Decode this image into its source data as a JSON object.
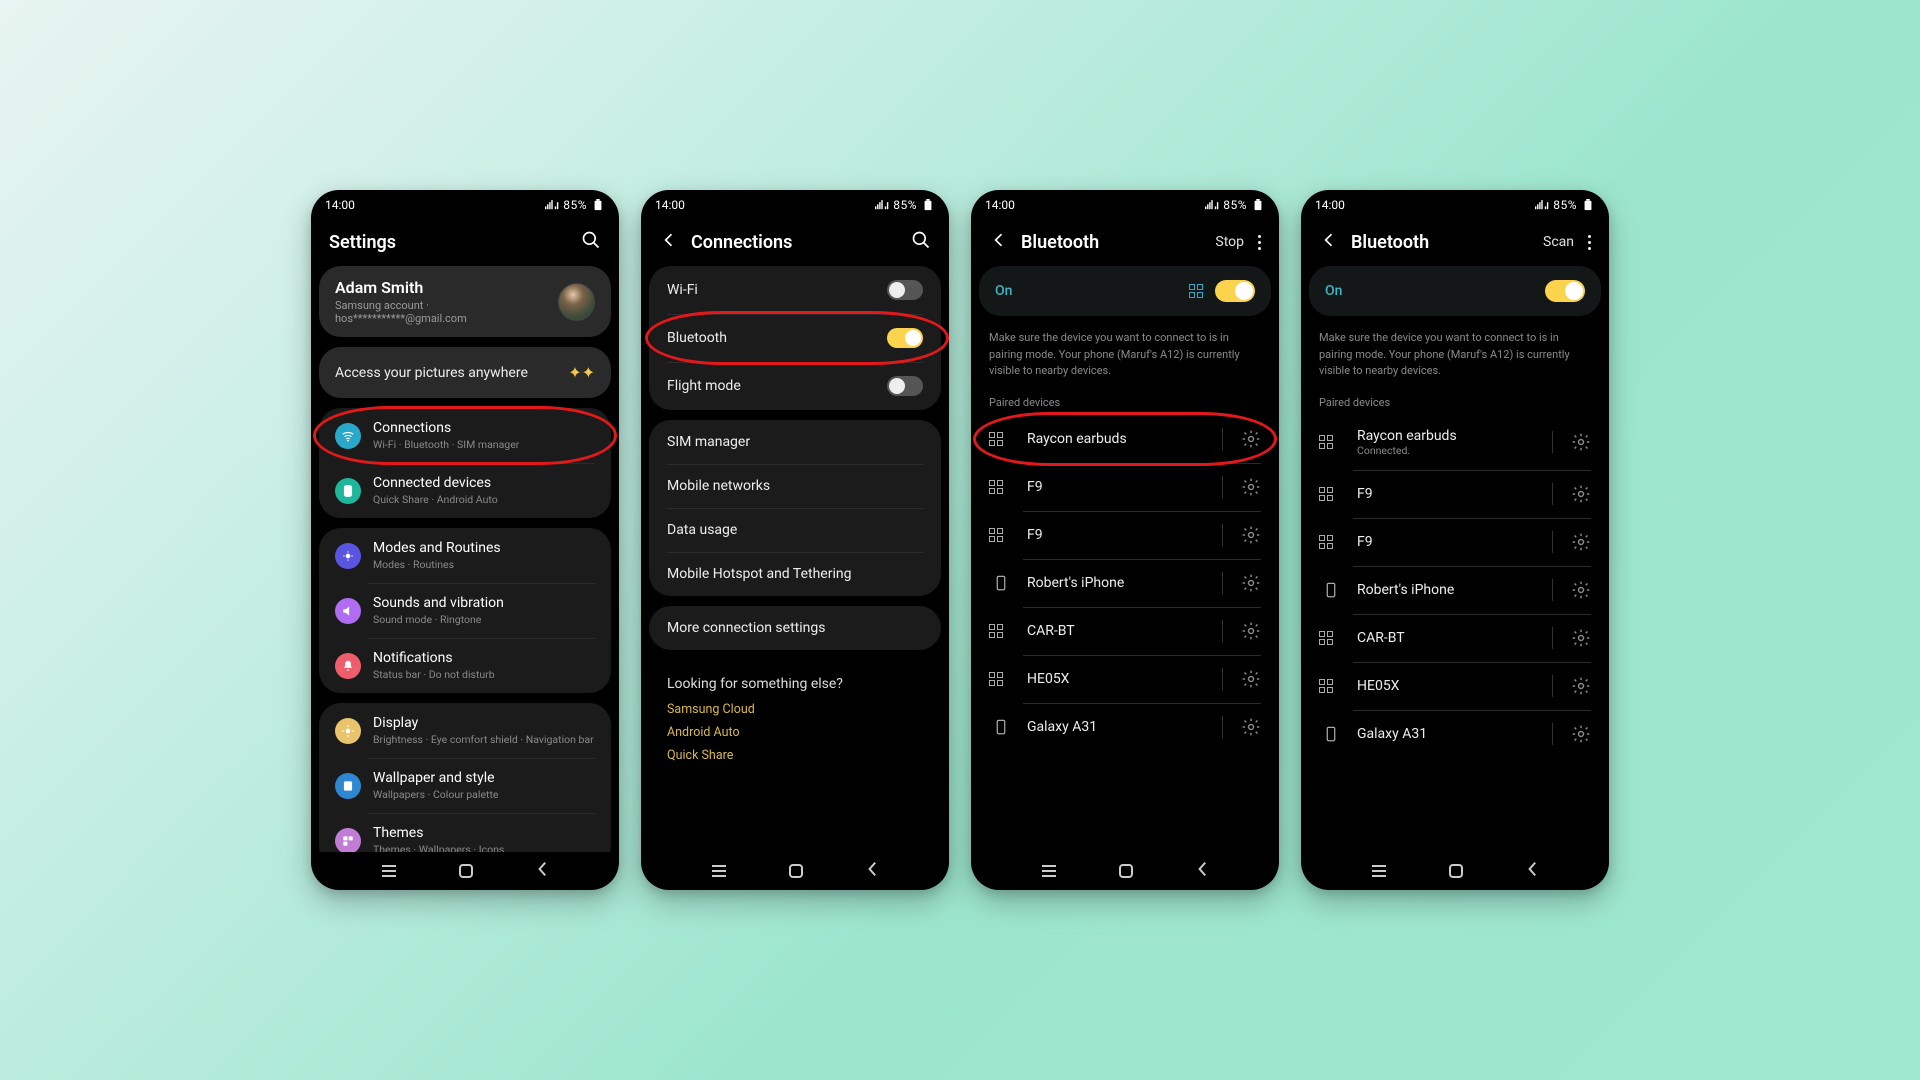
{
  "status": {
    "time": "14:00",
    "battery": "85%"
  },
  "s1": {
    "title": "Settings",
    "profile": {
      "name": "Adam Smith",
      "sub": "Samsung account · hos***********@gmail.com"
    },
    "promo": "Access your pictures anywhere",
    "groups": [
      {
        "items": [
          {
            "icon": "wifi",
            "color": "#2aa8c9",
            "label": "Connections",
            "sub": "Wi-Fi · Bluetooth · SIM manager",
            "hl": true
          },
          {
            "icon": "link",
            "color": "#1fb79b",
            "label": "Connected devices",
            "sub": "Quick Share · Android Auto"
          }
        ]
      },
      {
        "items": [
          {
            "icon": "modes",
            "color": "#5a55e0",
            "label": "Modes and Routines",
            "sub": "Modes · Routines"
          },
          {
            "icon": "sound",
            "color": "#b06cf2",
            "label": "Sounds and vibration",
            "sub": "Sound mode · Ringtone"
          },
          {
            "icon": "bell",
            "color": "#ee5d6c",
            "label": "Notifications",
            "sub": "Status bar · Do not disturb"
          }
        ]
      },
      {
        "items": [
          {
            "icon": "sun",
            "color": "#e9c46a",
            "label": "Display",
            "sub": "Brightness · Eye comfort shield · Navigation bar"
          },
          {
            "icon": "wall",
            "color": "#2f86d1",
            "label": "Wallpaper and style",
            "sub": "Wallpapers · Colour palette"
          },
          {
            "icon": "theme",
            "color": "#c17dd6",
            "label": "Themes",
            "sub": "Themes · Wallpapers · Icons"
          }
        ]
      }
    ]
  },
  "s2": {
    "title": "Connections",
    "rows": [
      {
        "label": "Wi-Fi",
        "toggle": true,
        "on": false
      },
      {
        "label": "Bluetooth",
        "toggle": true,
        "on": true,
        "hl": true
      },
      {
        "label": "Flight mode",
        "toggle": true,
        "on": false
      }
    ],
    "rows2": [
      {
        "label": "SIM manager"
      },
      {
        "label": "Mobile networks"
      },
      {
        "label": "Data usage"
      },
      {
        "label": "Mobile Hotspot and Tethering"
      }
    ],
    "rows3": [
      {
        "label": "More connection settings"
      }
    ],
    "suggest_q": "Looking for something else?",
    "suggest": [
      "Samsung Cloud",
      "Android Auto",
      "Quick Share"
    ]
  },
  "s3": {
    "title": "Bluetooth",
    "action": "Stop",
    "showQr": true,
    "on_label": "On",
    "help": "Make sure the device you want to connect to is in pairing mode. Your phone (Maruf's A12) is currently visible to nearby devices.",
    "section": "Paired devices",
    "devices": [
      {
        "type": "grid",
        "name": "Raycon earbuds",
        "hl": true
      },
      {
        "type": "grid",
        "name": "F9"
      },
      {
        "type": "grid",
        "name": "F9"
      },
      {
        "type": "phone",
        "name": "Robert's iPhone"
      },
      {
        "type": "grid",
        "name": "CAR-BT"
      },
      {
        "type": "grid",
        "name": "HE05X"
      },
      {
        "type": "phone",
        "name": "Galaxy A31"
      }
    ]
  },
  "s4": {
    "title": "Bluetooth",
    "action": "Scan",
    "showQr": false,
    "on_label": "On",
    "help": "Make sure the device you want to connect to is in pairing mode. Your phone (Maruf's A12) is currently visible to nearby devices.",
    "section": "Paired devices",
    "devices": [
      {
        "type": "grid",
        "name": "Raycon earbuds",
        "sub": "Connected."
      },
      {
        "type": "grid",
        "name": "F9"
      },
      {
        "type": "grid",
        "name": "F9"
      },
      {
        "type": "phone",
        "name": "Robert's iPhone"
      },
      {
        "type": "grid",
        "name": "CAR-BT"
      },
      {
        "type": "grid",
        "name": "HE05X"
      },
      {
        "type": "phone",
        "name": "Galaxy A31"
      }
    ]
  }
}
